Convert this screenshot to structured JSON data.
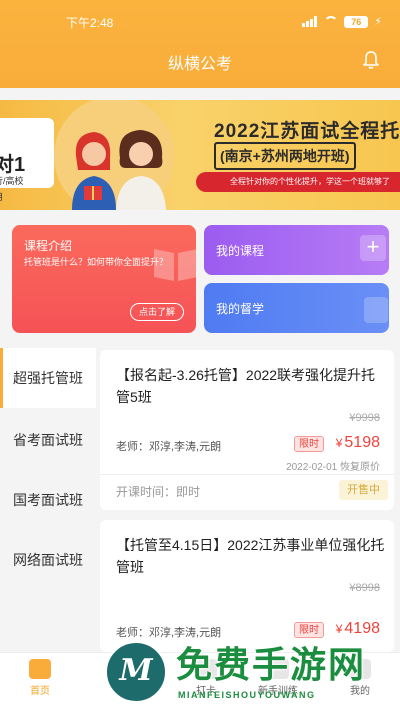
{
  "status_bar": {
    "time": "下午2:48",
    "battery": "76"
  },
  "header": {
    "title": "纵横公考"
  },
  "banner": {
    "left_big": "对1",
    "left_sub1": "行/高校",
    "left_sub2": "用",
    "title": "2022江苏面试全程托",
    "subtitle": "(南京+苏州两地开班)",
    "strip_text": "全程针对你的个性化提升，学这一个班就够了"
  },
  "cards": {
    "intro": {
      "title": "课程介绍",
      "desc": "托管班是什么？如何带你全面提升？",
      "button": "点击了解"
    },
    "my_course": {
      "label": "我的课程"
    },
    "my_study": {
      "label": "我的督学"
    }
  },
  "categories": [
    "超强托管班",
    "省考面试班",
    "国考面试班",
    "网络面试班"
  ],
  "courses": [
    {
      "title": "【报名起-3.26托管】2022联考强化提升托管5班",
      "old_price": "¥9998",
      "teacher": "老师：邓淳,李涛,元朗",
      "limit": "限时",
      "currency": "¥",
      "price": "5198",
      "date": "2022-02-01 恢复原价",
      "open_time": "开课时间：即时",
      "status": "开售中"
    },
    {
      "title": "【托管至4.15日】2022江苏事业单位强化托管班",
      "old_price": "¥8998",
      "teacher": "老师：邓淳,李涛,元朗",
      "limit": "限时",
      "currency": "¥",
      "price": "4198"
    }
  ],
  "bottom_nav": [
    "首页",
    "打卡",
    "新手训练",
    "我的"
  ],
  "watermark": {
    "logo_letter": "M",
    "text": "免费手游网",
    "sub": "MIANFEISHOUYOUWANG"
  }
}
